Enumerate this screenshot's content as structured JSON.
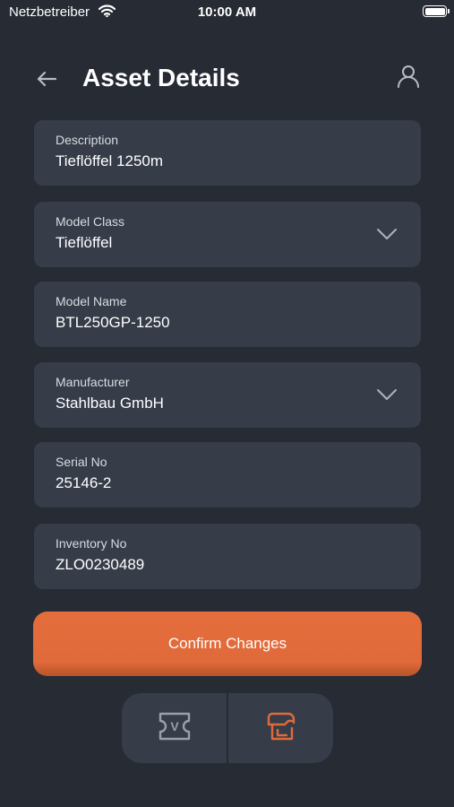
{
  "status_bar": {
    "carrier": "Netzbetreiber",
    "time": "10:00 AM"
  },
  "header": {
    "title": "Asset Details"
  },
  "fields": [
    {
      "label": "Description",
      "value": "Tieflöffel 1250m",
      "type": "text"
    },
    {
      "label": "Model Class",
      "value": "Tieflöffel",
      "type": "dropdown"
    },
    {
      "label": "Model Name",
      "value": "BTL250GP-1250",
      "type": "text"
    },
    {
      "label": "Manufacturer",
      "value": "Stahlbau GmbH",
      "type": "dropdown"
    },
    {
      "label": "Serial No",
      "value": "25146-2",
      "type": "text"
    },
    {
      "label": "Inventory No",
      "value": "ZLO0230489",
      "type": "text"
    }
  ],
  "actions": {
    "confirm_label": "Confirm Changes"
  },
  "bottom_nav": {
    "items": [
      {
        "icon": "voucher-icon",
        "glyph": "V",
        "active": false
      },
      {
        "icon": "asset-scan-icon",
        "active": true
      }
    ]
  },
  "colors": {
    "background": "#262b34",
    "card": "#363c48",
    "accent": "#e06a3a",
    "icon_muted": "#9aa0aa"
  }
}
